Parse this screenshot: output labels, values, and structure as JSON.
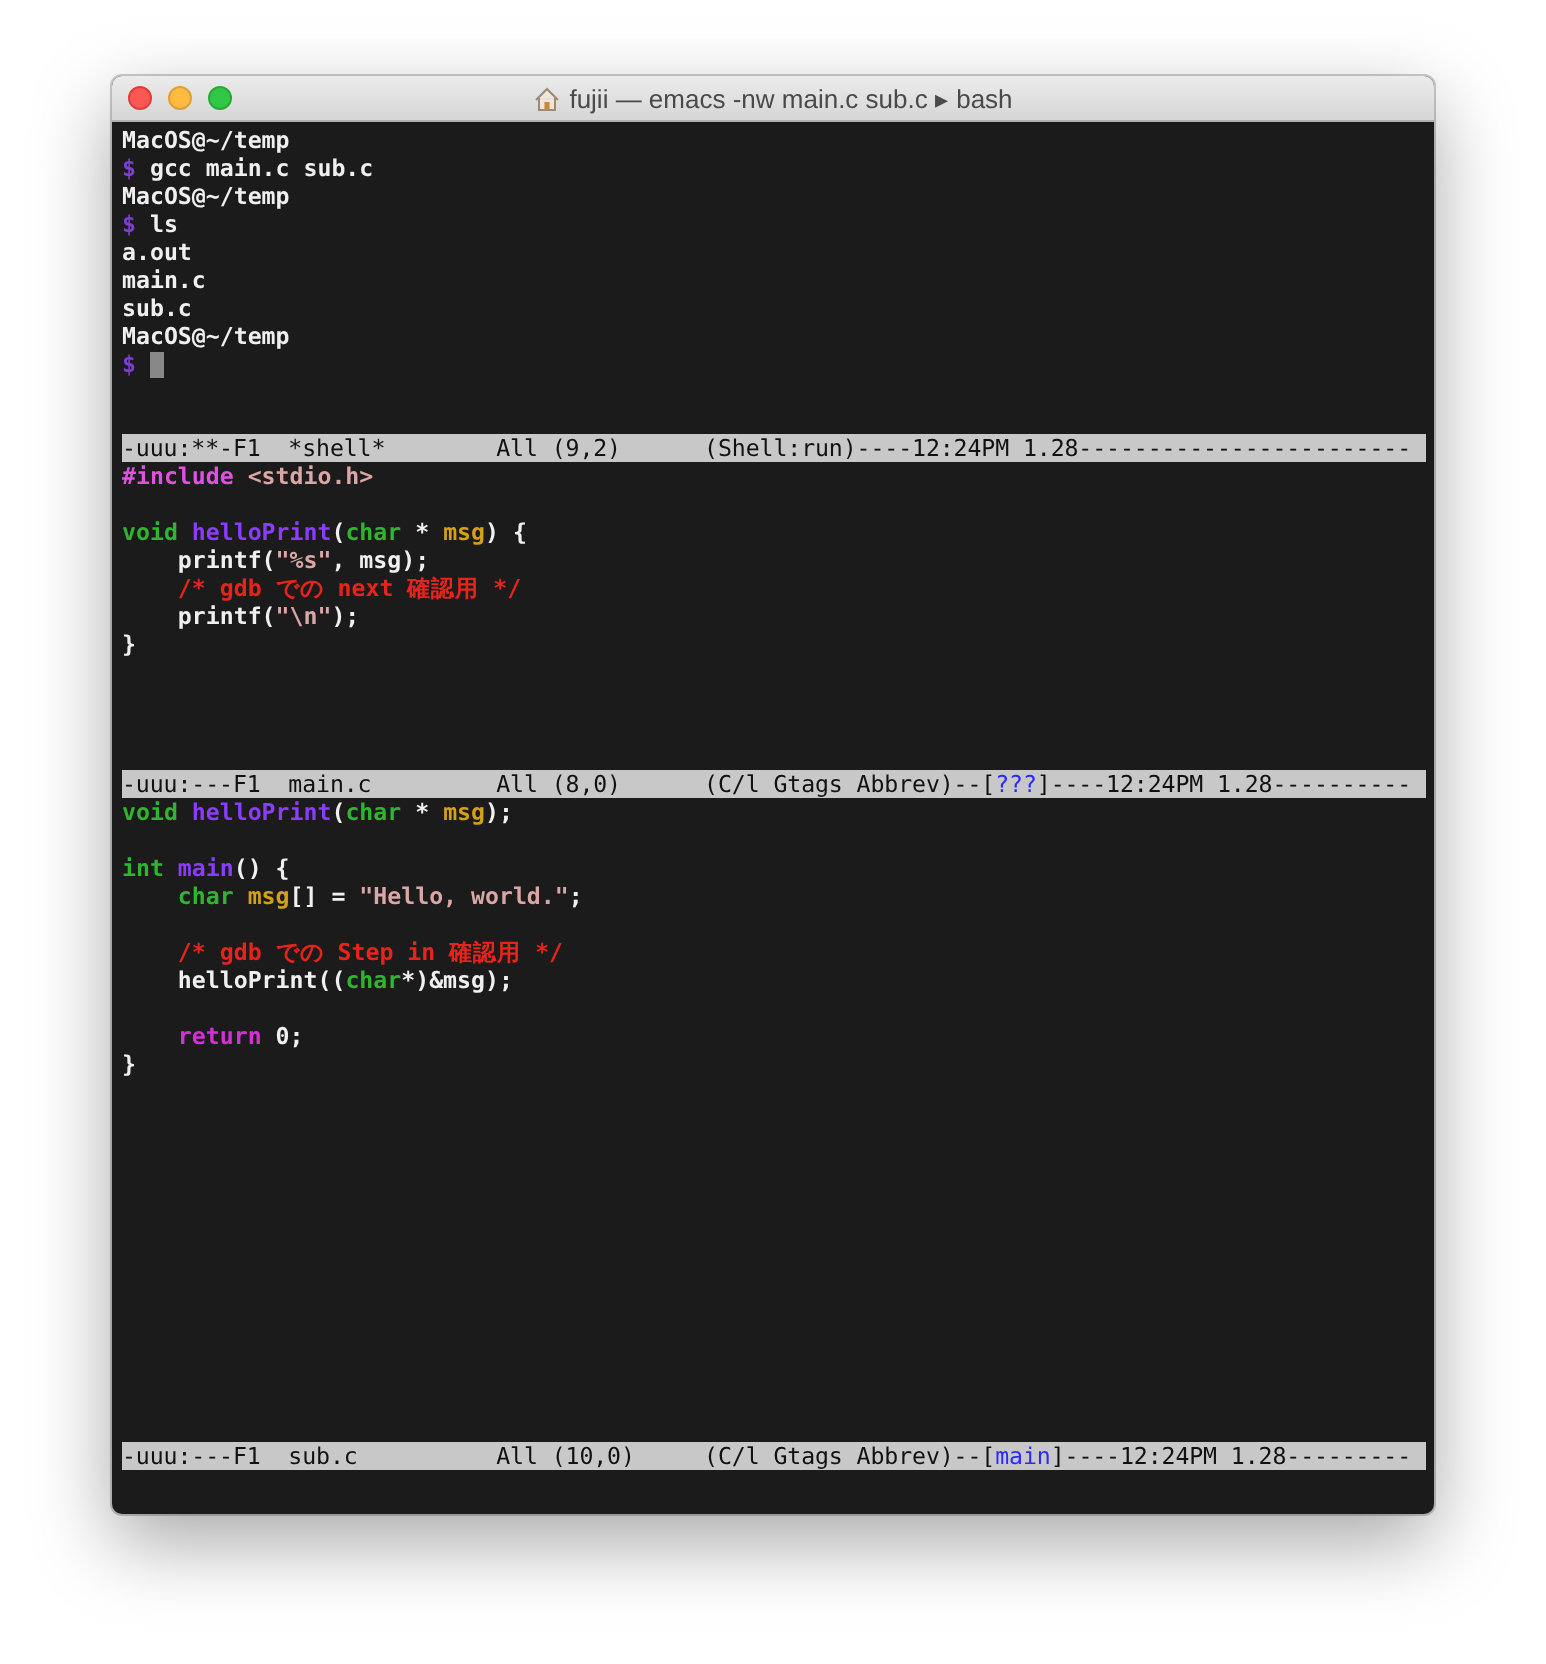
{
  "window": {
    "title": "fujii — emacs -nw main.c sub.c ▸ bash"
  },
  "panes": [
    {
      "blocks": [
        {
          "lines": [
            {
              "tokens": [
                {
                  "kind": "plain",
                  "text": "MacOS@~/temp"
                }
              ]
            },
            {
              "tokens": [
                {
                  "kind": "prompt",
                  "text": "$"
                },
                {
                  "kind": "plain",
                  "text": " gcc main.c sub.c"
                }
              ]
            },
            {
              "tokens": [
                {
                  "kind": "plain",
                  "text": "MacOS@~/temp"
                }
              ]
            },
            {
              "tokens": [
                {
                  "kind": "prompt",
                  "text": "$"
                },
                {
                  "kind": "plain",
                  "text": " ls"
                }
              ]
            },
            {
              "tokens": [
                {
                  "kind": "plain",
                  "text": "a.out"
                }
              ]
            },
            {
              "tokens": [
                {
                  "kind": "plain",
                  "text": "main.c"
                }
              ]
            },
            {
              "tokens": [
                {
                  "kind": "plain",
                  "text": "sub.c"
                }
              ]
            },
            {
              "tokens": [
                {
                  "kind": "plain",
                  "text": "MacOS@~/temp"
                }
              ]
            },
            {
              "cursor": true,
              "tokens": [
                {
                  "kind": "prompt",
                  "text": "$"
                }
              ]
            }
          ]
        }
      ],
      "mode_line": [
        {
          "kind": "plain",
          "text": "-uuu:**-F1  *shell*        All (9,2)      (Shell:run)----12:24PM 1.28------------------------"
        }
      ]
    },
    {
      "blocks": [
        {
          "lines": [
            {
              "tokens": [
                {
                  "kind": "preproc",
                  "text": "#include"
                },
                {
                  "kind": "string",
                  "text": " <stdio.h>"
                }
              ]
            }
          ]
        },
        {
          "lines": [
            {
              "tokens": [
                {
                  "kind": "type",
                  "text": "void"
                },
                {
                  "kind": "func",
                  "text": " helloPrint"
                },
                {
                  "kind": "plain",
                  "text": "("
                },
                {
                  "kind": "type",
                  "text": "char"
                },
                {
                  "kind": "plain",
                  "text": " * "
                },
                {
                  "kind": "var",
                  "text": "msg"
                },
                {
                  "kind": "plain",
                  "text": ") {"
                }
              ]
            },
            {
              "tokens": [
                {
                  "kind": "plain",
                  "text": "    printf("
                },
                {
                  "kind": "string",
                  "text": "\"%s\""
                },
                {
                  "kind": "plain",
                  "text": ", msg);"
                }
              ]
            },
            {
              "tokens": [
                {
                  "kind": "comment",
                  "text": "    /* gdb での next 確認用 */"
                }
              ]
            },
            {
              "tokens": [
                {
                  "kind": "plain",
                  "text": "    printf("
                },
                {
                  "kind": "string",
                  "text": "\"\\n\""
                },
                {
                  "kind": "plain",
                  "text": ");"
                }
              ]
            },
            {
              "tokens": [
                {
                  "kind": "plain",
                  "text": "}"
                }
              ]
            }
          ]
        }
      ],
      "mode_line": [
        {
          "kind": "plain",
          "text": "-uuu:---F1  main.c         All (8,0)      (C/l Gtags Abbrev)--["
        },
        {
          "kind": "link",
          "text": "???"
        },
        {
          "kind": "plain",
          "text": "]----12:24PM 1.28----------"
        }
      ]
    },
    {
      "blocks": [
        {
          "lines": [
            {
              "tokens": [
                {
                  "kind": "type",
                  "text": "void"
                },
                {
                  "kind": "func",
                  "text": " helloPrint"
                },
                {
                  "kind": "plain",
                  "text": "("
                },
                {
                  "kind": "type",
                  "text": "char"
                },
                {
                  "kind": "plain",
                  "text": " * "
                },
                {
                  "kind": "var",
                  "text": "msg"
                },
                {
                  "kind": "plain",
                  "text": ");"
                }
              ]
            }
          ]
        },
        {
          "lines": [
            {
              "tokens": [
                {
                  "kind": "type",
                  "text": "int"
                },
                {
                  "kind": "func",
                  "text": " main"
                },
                {
                  "kind": "plain",
                  "text": "() {"
                }
              ]
            },
            {
              "tokens": [
                {
                  "kind": "type",
                  "text": "    char"
                },
                {
                  "kind": "var",
                  "text": " msg"
                },
                {
                  "kind": "plain",
                  "text": "[] = "
                },
                {
                  "kind": "string",
                  "text": "\"Hello, world.\""
                },
                {
                  "kind": "plain",
                  "text": ";"
                }
              ]
            }
          ]
        },
        {
          "lines": [
            {
              "tokens": [
                {
                  "kind": "comment",
                  "text": "    /* gdb での Step in 確認用 */"
                }
              ]
            },
            {
              "tokens": [
                {
                  "kind": "plain",
                  "text": "    helloPrint(("
                },
                {
                  "kind": "type",
                  "text": "char"
                },
                {
                  "kind": "plain",
                  "text": "*)&msg);"
                }
              ]
            }
          ]
        },
        {
          "lines": [
            {
              "tokens": [
                {
                  "kind": "keyword",
                  "text": "    return"
                },
                {
                  "kind": "plain",
                  "text": " 0;"
                }
              ]
            },
            {
              "tokens": [
                {
                  "kind": "plain",
                  "text": "}"
                }
              ]
            }
          ]
        }
      ],
      "mode_line": [
        {
          "kind": "plain",
          "text": "-uuu:---F1  sub.c          All (10,0)     (C/l Gtags Abbrev)--["
        },
        {
          "kind": "link",
          "text": "main"
        },
        {
          "kind": "plain",
          "text": "]----12:24PM 1.28---------"
        }
      ]
    }
  ]
}
